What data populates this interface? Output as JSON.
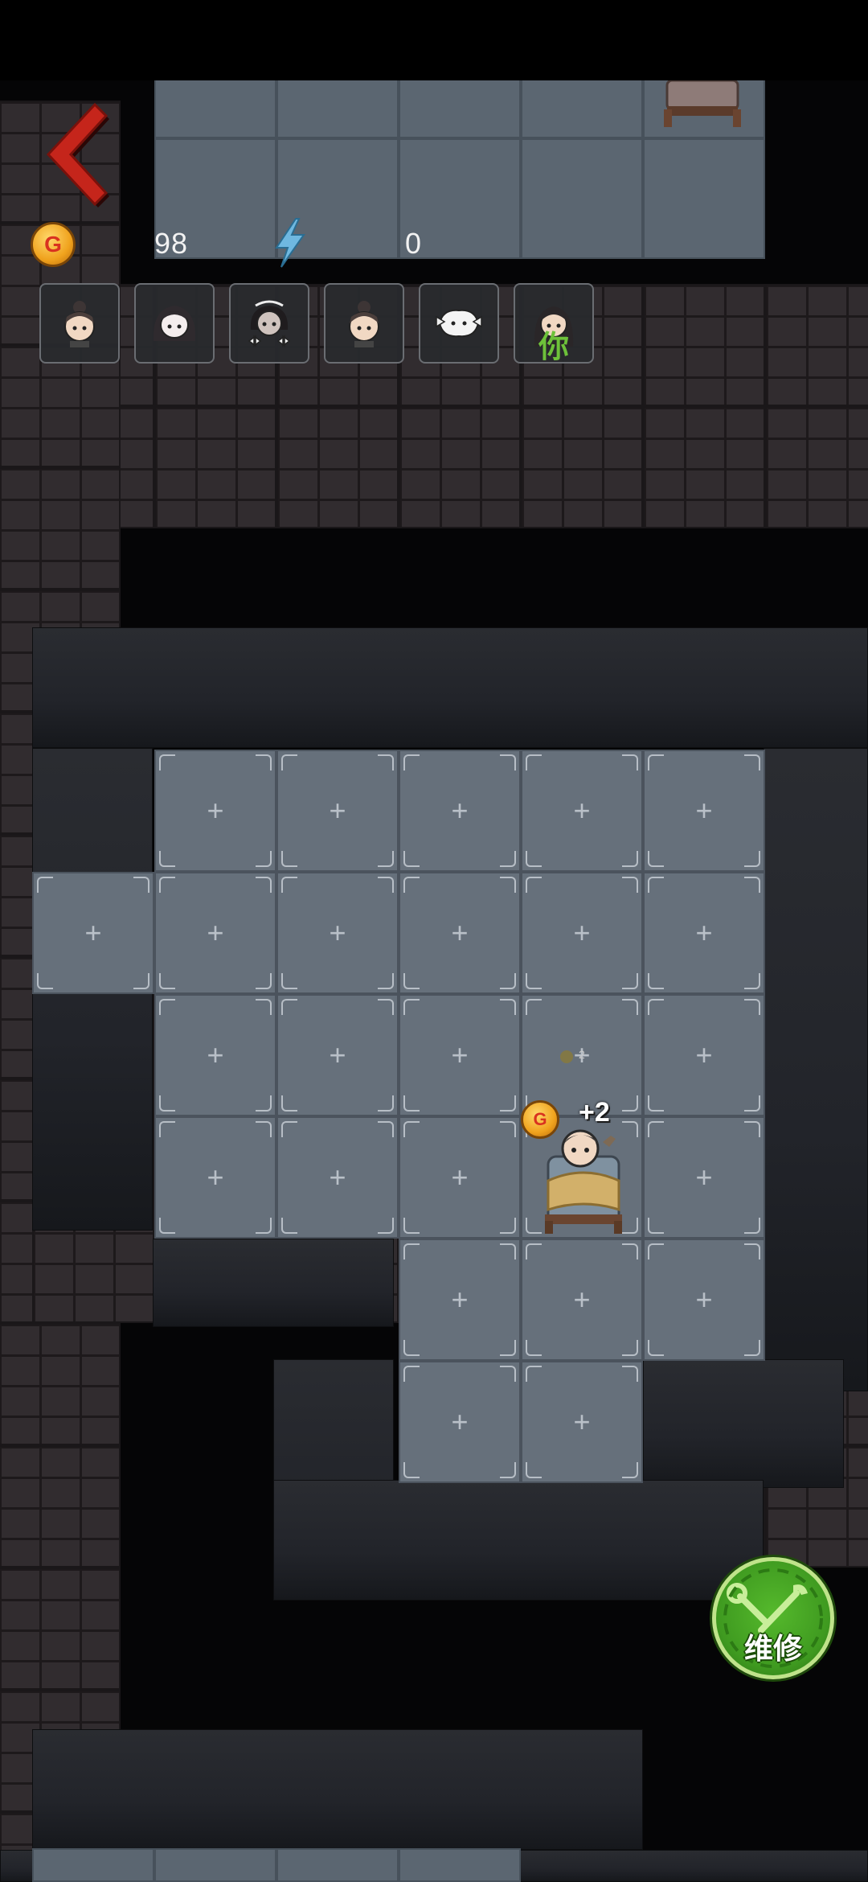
{
  "hud": {
    "gold_value": "98",
    "energy_value": "0",
    "coin_symbol": "G",
    "back_icon": "back-arrow-icon",
    "energy_icon": "lightning-icon"
  },
  "players": [
    {
      "icon": "player-avatar-girl-bun-icon"
    },
    {
      "icon": "player-avatar-long-hair-icon"
    },
    {
      "icon": "player-avatar-dark-hair-bows-icon"
    },
    {
      "icon": "player-avatar-girl-bun-icon"
    },
    {
      "icon": "player-avatar-ghost-icon"
    },
    {
      "icon": "player-avatar-you-icon",
      "label": "你"
    }
  ],
  "room": {
    "reward_text": "+2",
    "reward_coin_symbol": "G",
    "faint_label": "2",
    "tile_symbol": "+"
  },
  "repair_button": {
    "label": "维修",
    "icon": "wrench-gear-icon"
  },
  "colors": {
    "background": "#050506",
    "brick": "#312c2f",
    "floor_tile": "#66707b",
    "back_arrow": "#c5251b",
    "repair_green": "#3f9a20",
    "you_label": "#6dc13a",
    "coin": "#f0a21d"
  }
}
